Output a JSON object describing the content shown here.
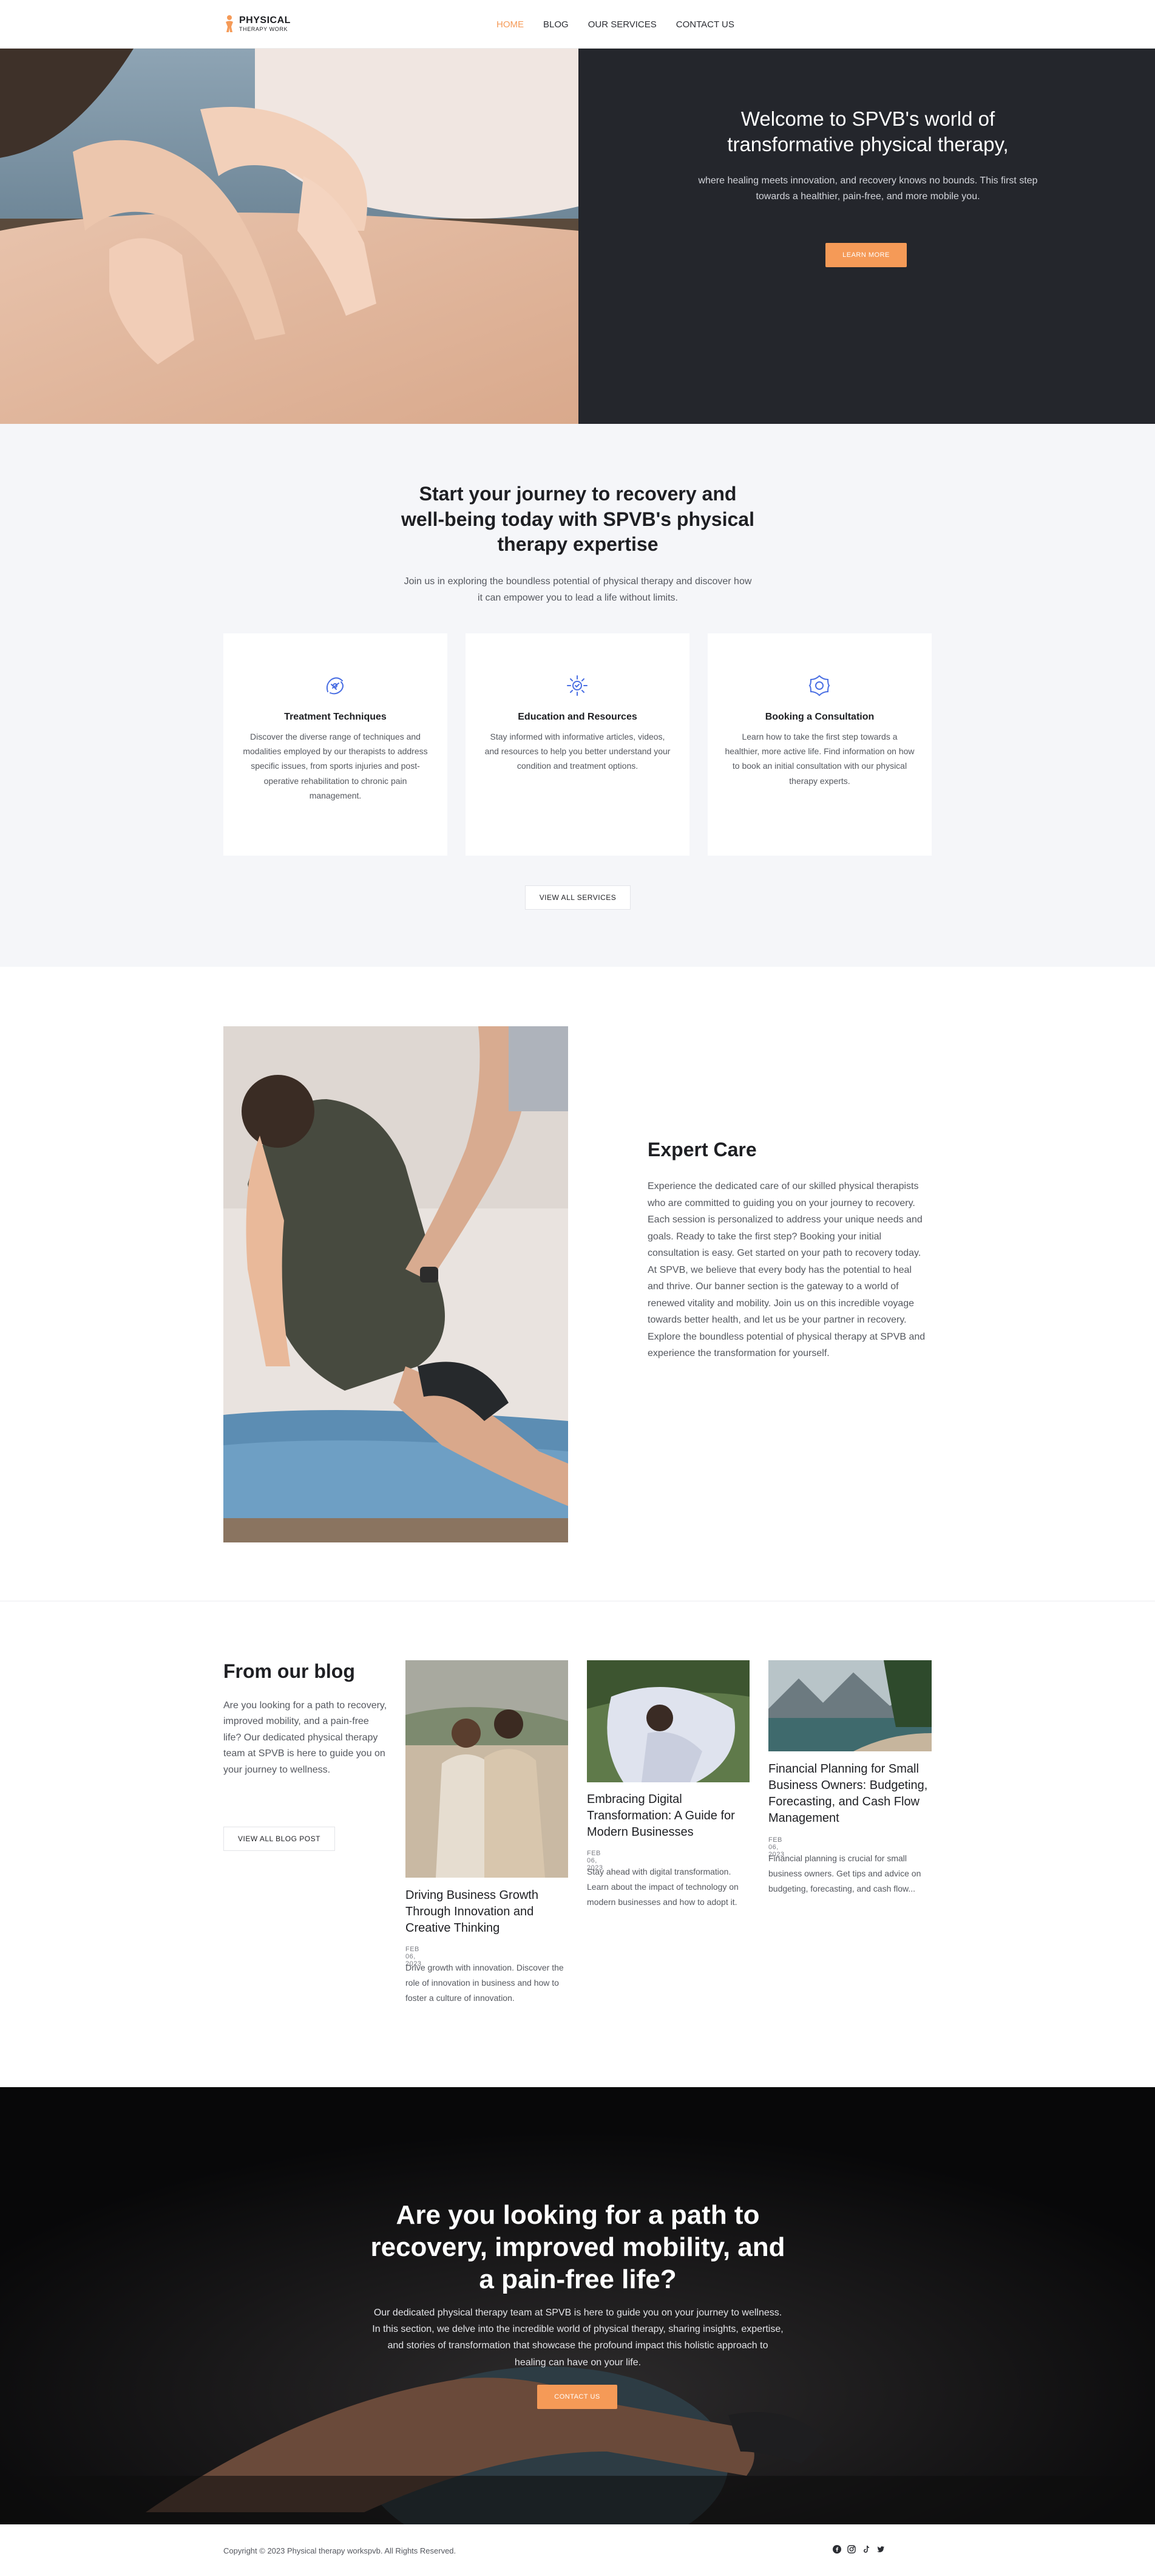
{
  "header": {
    "logo_line1": "PHYSICAL",
    "logo_line2": "THERAPY WORK",
    "nav": [
      {
        "label": "HOME",
        "active": true
      },
      {
        "label": "BLOG",
        "active": false
      },
      {
        "label": "OUR SERVICES",
        "active": false
      },
      {
        "label": "CONTACT US",
        "active": false
      }
    ]
  },
  "hero": {
    "title": "Welcome to SPVB's world of transformative physical therapy,",
    "subtitle": "where healing meets innovation, and recovery knows no bounds. This first step towards a healthier, pain-free, and more mobile you.",
    "button": "LEARN MORE"
  },
  "services": {
    "title": "Start your journey to recovery and well-being today with SPVB's physical therapy expertise",
    "subtitle": "Join us in exploring the boundless potential of physical therapy and discover how it can empower you to lead a life without limits.",
    "cards": [
      {
        "icon": "treatment-icon",
        "title": "Treatment Techniques",
        "text": "Discover the diverse range of techniques and modalities employed by our therapists to address specific issues, from sports injuries and post-operative rehabilitation to chronic pain management."
      },
      {
        "icon": "education-icon",
        "title": "Education and Resources",
        "text": "Stay informed with informative articles, videos, and resources to help you better understand your condition and treatment options."
      },
      {
        "icon": "consultation-icon",
        "title": "Booking a Consultation",
        "text": "Learn how to take the first step towards a healthier, more active life. Find information on how to book an initial consultation with our physical therapy experts."
      }
    ],
    "button": "VIEW ALL SERVICES"
  },
  "expert": {
    "title": "Expert Care",
    "text": "Experience the dedicated care of our skilled physical therapists who are committed to guiding you on your journey to recovery. Each session is personalized to address your unique needs and goals. Ready to take the first step? Booking your initial consultation is easy. Get started on your path to recovery today. At SPVB, we believe that every body has the potential to heal and thrive. Our banner section is the gateway to a world of renewed vitality and mobility. Join us on this incredible voyage towards better health, and let us be your partner in recovery. Explore the boundless potential of physical therapy at SPVB and experience the transformation for yourself."
  },
  "blog": {
    "title": "From our blog",
    "intro": "Are you looking for a path to recovery, improved mobility, and a pain-free life? Our dedicated physical therapy team at SPVB is here to guide you on your journey to wellness.",
    "button": "VIEW ALL BLOG POST",
    "posts": [
      {
        "title": "Driving Business Growth Through Innovation and Creative Thinking",
        "date": "FEB 06, 2023",
        "excerpt": "Drive growth with innovation. Discover the role of innovation in business and how to foster a culture of innovation."
      },
      {
        "title": "Embracing Digital Transformation: A Guide for Modern Businesses",
        "date": "FEB 06, 2023",
        "excerpt": "Stay ahead with digital transformation. Learn about the impact of technology on modern businesses and how to adopt it."
      },
      {
        "title": "Financial Planning for Small Business Owners: Budgeting, Forecasting, and Cash Flow Management",
        "date": "FEB 06, 2023",
        "excerpt": "Financial planning is crucial for small business owners. Get tips and advice on budgeting, forecasting, and cash flow..."
      }
    ]
  },
  "cta": {
    "title": "Are you looking for a path to recovery, improved mobility, and a pain-free life?",
    "text": "Our dedicated physical therapy team at SPVB is here to guide you on your journey to wellness. In this section, we delve into the incredible world of physical therapy, sharing insights, expertise, and stories of transformation that showcase the profound impact this holistic approach to healing can have on your life.",
    "button": "CONTACT US"
  },
  "footer": {
    "copyright": "Copyright © 2023 Physical therapy workspvb. All Rights Reserved.",
    "socials": [
      "facebook-icon",
      "instagram-icon",
      "tiktok-icon",
      "twitter-icon"
    ]
  },
  "colors": {
    "accent": "#f59a57",
    "dark": "#24262c",
    "icon_blue": "#4a6fe3",
    "light_bg": "#f5f6f9"
  }
}
